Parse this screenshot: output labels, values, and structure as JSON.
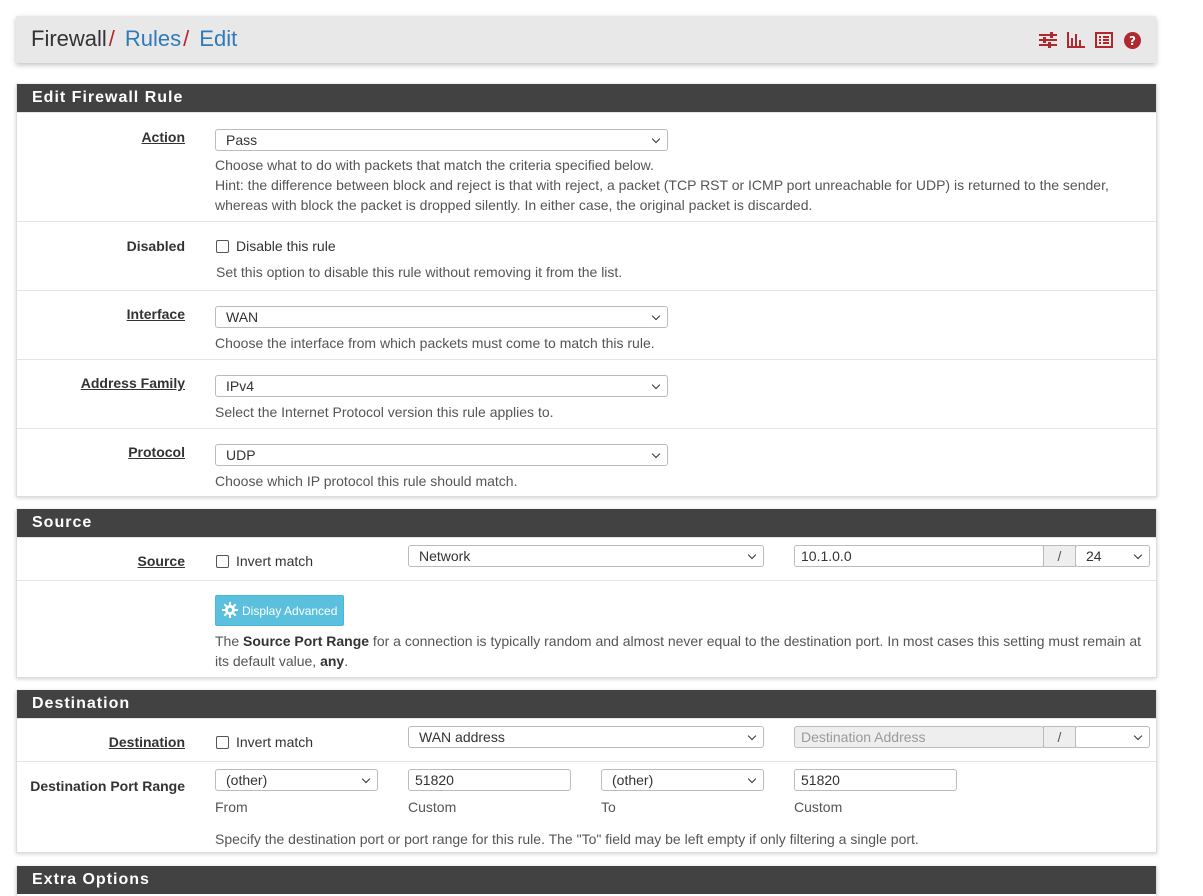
{
  "breadcrumb": {
    "root": "Firewall",
    "sep": "/",
    "rules": "Rules",
    "edit": "Edit"
  },
  "header_icons": [
    "sliders-icon",
    "bar-chart-icon",
    "list-icon",
    "help-icon"
  ],
  "colors": {
    "accent_red": "#b0282e",
    "link_blue": "#317ab9",
    "panel_heading": "#424242",
    "info_button": "#5bc0de"
  },
  "edit_panel": {
    "title": "Edit Firewall Rule",
    "action": {
      "label": "Action",
      "value": "Pass",
      "help1": "Choose what to do with packets that match the criteria specified below.",
      "help2": "Hint: the difference between block and reject is that with reject, a packet (TCP RST or ICMP port unreachable for UDP) is returned to the sender, whereas with block the packet is dropped silently. In either case, the original packet is discarded."
    },
    "disabled": {
      "label": "Disabled",
      "checkbox_label": "Disable this rule",
      "help": "Set this option to disable this rule without removing it from the list."
    },
    "interface": {
      "label": "Interface",
      "value": "WAN",
      "help": "Choose the interface from which packets must come to match this rule."
    },
    "address_family": {
      "label": "Address Family",
      "value": "IPv4",
      "help": "Select the Internet Protocol version this rule applies to."
    },
    "protocol": {
      "label": "Protocol",
      "value": "UDP",
      "help": "Choose which IP protocol this rule should match."
    }
  },
  "source_panel": {
    "title": "Source",
    "label": "Source",
    "invert_label": "Invert match",
    "type": "Network",
    "address": "10.1.0.0",
    "slash": "/",
    "mask": "24",
    "advanced_button": "Display Advanced",
    "help_pre": "The ",
    "help_bold": "Source Port Range",
    "help_mid": " for a connection is typically random and almost never equal to the destination port. In most cases this setting must remain at its default value, ",
    "help_any": "any",
    "help_end": "."
  },
  "destination_panel": {
    "title": "Destination",
    "label": "Destination",
    "invert_label": "Invert match",
    "type": "WAN address",
    "address_placeholder": "Destination Address",
    "slash": "/",
    "mask": "",
    "port_range": {
      "label": "Destination Port Range",
      "from_select": "(other)",
      "from_custom": "51820",
      "to_select": "(other)",
      "to_custom": "51820",
      "from_caption": "From",
      "custom_caption1": "Custom",
      "to_caption": "To",
      "custom_caption2": "Custom",
      "help": "Specify the destination port or port range for this rule. The \"To\" field may be left empty if only filtering a single port."
    }
  },
  "extra_panel": {
    "title": "Extra Options"
  }
}
